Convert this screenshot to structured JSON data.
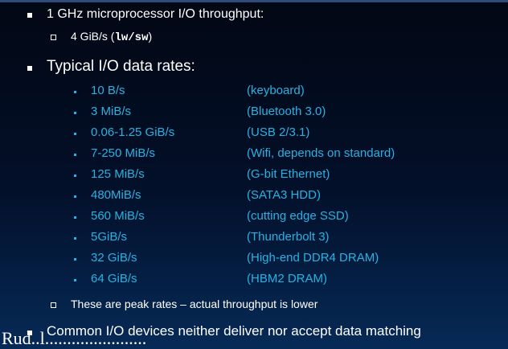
{
  "bullets": {
    "b1": "1 GHz microprocessor I/O throughput:",
    "b1_sub_prefix": "4 GiB/s (",
    "b1_sub_code": "lw/sw",
    "b1_sub_suffix": ")",
    "b2": "Typical I/O data rates:",
    "rates": [
      {
        "rate": "10 B/s",
        "device": "(keyboard)"
      },
      {
        "rate": "3 MiB/s",
        "device": "(Bluetooth 3.0)"
      },
      {
        "rate": "0.06-1.25 GiB/s",
        "device": "(USB 2/3.1)"
      },
      {
        "rate": "7-250 MiB/s",
        "device": "(Wifi, depends on standard)"
      },
      {
        "rate": "125 MiB/s",
        "device": "(G-bit Ethernet)"
      },
      {
        "rate": "480MiB/s",
        "device": "(SATA3 HDD)"
      },
      {
        "rate": "560 MiB/s",
        "device": "(cutting edge SSD)"
      },
      {
        "rate": "5GiB/s",
        "device": "(Thunderbolt 3)"
      },
      {
        "rate": "32 GiB/s",
        "device": "(High-end DDR4 DRAM)"
      },
      {
        "rate": "64 GiB/s",
        "device": "(HBM2 DRAM)"
      }
    ],
    "b2_note": "These are peak rates – actual throughput is lower",
    "b3": "Common I/O devices neither deliver nor accept data matching"
  },
  "bottom_overflow": "Rud..l.......................",
  "colors": {
    "accent": "#26b3e4",
    "text": "#ffffff"
  }
}
